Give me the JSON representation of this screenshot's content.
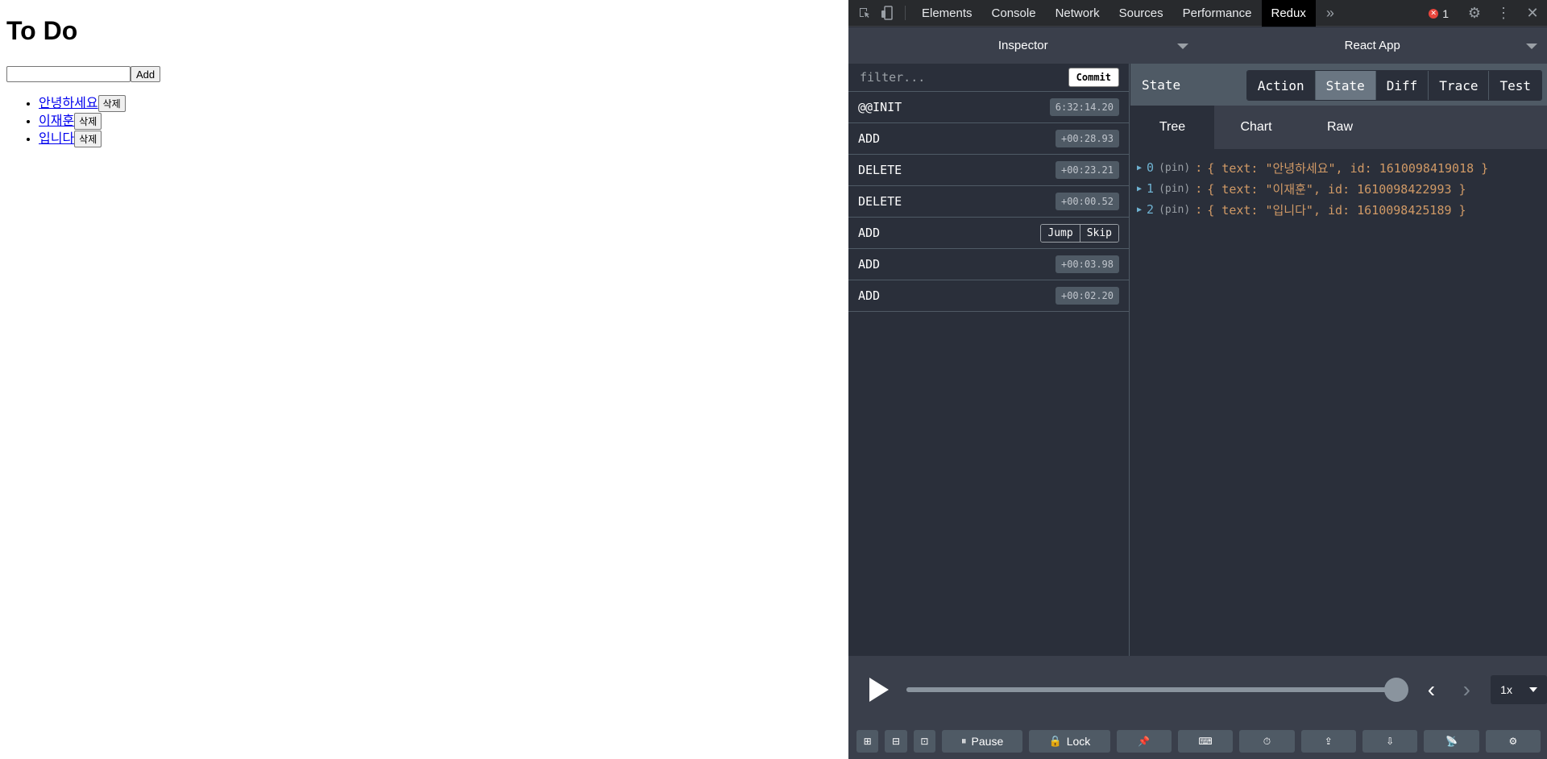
{
  "page": {
    "title": "To Do",
    "add_button": "Add",
    "input_value": "",
    "todos": [
      {
        "text": "안녕하세요",
        "delete_label": "삭제"
      },
      {
        "text": "이재훈",
        "delete_label": "삭제"
      },
      {
        "text": "입니다",
        "delete_label": "삭제"
      }
    ]
  },
  "devtools": {
    "tabs": [
      "Elements",
      "Console",
      "Network",
      "Sources",
      "Performance",
      "Redux"
    ],
    "active_tab": "Redux",
    "more_tabs_icon": "»",
    "error_count": "1",
    "monitor": "Inspector",
    "instance": "React App",
    "filter_placeholder": "filter...",
    "commit_label": "Commit",
    "actions": [
      {
        "type": "@@INIT",
        "time": "6:32:14.20"
      },
      {
        "type": "ADD",
        "time": "+00:28.93"
      },
      {
        "type": "DELETE",
        "time": "+00:23.21"
      },
      {
        "type": "DELETE",
        "time": "+00:00.52"
      },
      {
        "type": "ADD",
        "jump": "Jump",
        "skip": "Skip"
      },
      {
        "type": "ADD",
        "time": "+00:03.98"
      },
      {
        "type": "ADD",
        "time": "+00:02.20"
      }
    ],
    "state_title": "State",
    "state_tabs": [
      "Action",
      "State",
      "Diff",
      "Trace",
      "Test"
    ],
    "active_state_tab": "State",
    "view_tabs": [
      "Tree",
      "Chart",
      "Raw"
    ],
    "active_view_tab": "Tree",
    "tree": [
      {
        "key": "0",
        "pin": "(pin)",
        "value": "{ text: \"안녕하세요\", id: 1610098419018 }"
      },
      {
        "key": "1",
        "pin": "(pin)",
        "value": "{ text: \"이재훈\", id: 1610098422993 }"
      },
      {
        "key": "2",
        "pin": "(pin)",
        "value": "{ text: \"입니다\", id: 1610098425189 }"
      }
    ],
    "slider_position": 1.0,
    "speed": "1x",
    "bottom_buttons": {
      "pause": "Pause",
      "lock": "Lock"
    }
  },
  "colors": {
    "panel_bg": "#2a2f3a",
    "header_bg": "#4f5a65",
    "tree_key": "#6fb3d2",
    "tree_value": "#d19a66",
    "link": "#0000ee"
  }
}
